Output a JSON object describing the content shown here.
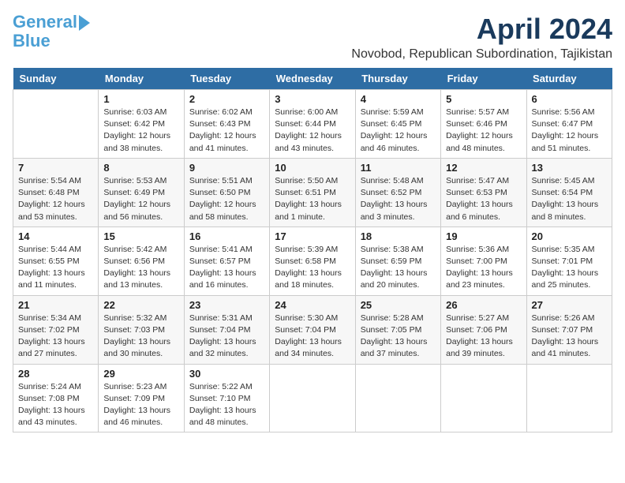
{
  "logo": {
    "line1": "General",
    "line2": "Blue"
  },
  "title": "April 2024",
  "location": "Novobod, Republican Subordination, Tajikistan",
  "header_days": [
    "Sunday",
    "Monday",
    "Tuesday",
    "Wednesday",
    "Thursday",
    "Friday",
    "Saturday"
  ],
  "weeks": [
    [
      {
        "day": "",
        "info": ""
      },
      {
        "day": "1",
        "info": "Sunrise: 6:03 AM\nSunset: 6:42 PM\nDaylight: 12 hours\nand 38 minutes."
      },
      {
        "day": "2",
        "info": "Sunrise: 6:02 AM\nSunset: 6:43 PM\nDaylight: 12 hours\nand 41 minutes."
      },
      {
        "day": "3",
        "info": "Sunrise: 6:00 AM\nSunset: 6:44 PM\nDaylight: 12 hours\nand 43 minutes."
      },
      {
        "day": "4",
        "info": "Sunrise: 5:59 AM\nSunset: 6:45 PM\nDaylight: 12 hours\nand 46 minutes."
      },
      {
        "day": "5",
        "info": "Sunrise: 5:57 AM\nSunset: 6:46 PM\nDaylight: 12 hours\nand 48 minutes."
      },
      {
        "day": "6",
        "info": "Sunrise: 5:56 AM\nSunset: 6:47 PM\nDaylight: 12 hours\nand 51 minutes."
      }
    ],
    [
      {
        "day": "7",
        "info": "Sunrise: 5:54 AM\nSunset: 6:48 PM\nDaylight: 12 hours\nand 53 minutes."
      },
      {
        "day": "8",
        "info": "Sunrise: 5:53 AM\nSunset: 6:49 PM\nDaylight: 12 hours\nand 56 minutes."
      },
      {
        "day": "9",
        "info": "Sunrise: 5:51 AM\nSunset: 6:50 PM\nDaylight: 12 hours\nand 58 minutes."
      },
      {
        "day": "10",
        "info": "Sunrise: 5:50 AM\nSunset: 6:51 PM\nDaylight: 13 hours\nand 1 minute."
      },
      {
        "day": "11",
        "info": "Sunrise: 5:48 AM\nSunset: 6:52 PM\nDaylight: 13 hours\nand 3 minutes."
      },
      {
        "day": "12",
        "info": "Sunrise: 5:47 AM\nSunset: 6:53 PM\nDaylight: 13 hours\nand 6 minutes."
      },
      {
        "day": "13",
        "info": "Sunrise: 5:45 AM\nSunset: 6:54 PM\nDaylight: 13 hours\nand 8 minutes."
      }
    ],
    [
      {
        "day": "14",
        "info": "Sunrise: 5:44 AM\nSunset: 6:55 PM\nDaylight: 13 hours\nand 11 minutes."
      },
      {
        "day": "15",
        "info": "Sunrise: 5:42 AM\nSunset: 6:56 PM\nDaylight: 13 hours\nand 13 minutes."
      },
      {
        "day": "16",
        "info": "Sunrise: 5:41 AM\nSunset: 6:57 PM\nDaylight: 13 hours\nand 16 minutes."
      },
      {
        "day": "17",
        "info": "Sunrise: 5:39 AM\nSunset: 6:58 PM\nDaylight: 13 hours\nand 18 minutes."
      },
      {
        "day": "18",
        "info": "Sunrise: 5:38 AM\nSunset: 6:59 PM\nDaylight: 13 hours\nand 20 minutes."
      },
      {
        "day": "19",
        "info": "Sunrise: 5:36 AM\nSunset: 7:00 PM\nDaylight: 13 hours\nand 23 minutes."
      },
      {
        "day": "20",
        "info": "Sunrise: 5:35 AM\nSunset: 7:01 PM\nDaylight: 13 hours\nand 25 minutes."
      }
    ],
    [
      {
        "day": "21",
        "info": "Sunrise: 5:34 AM\nSunset: 7:02 PM\nDaylight: 13 hours\nand 27 minutes."
      },
      {
        "day": "22",
        "info": "Sunrise: 5:32 AM\nSunset: 7:03 PM\nDaylight: 13 hours\nand 30 minutes."
      },
      {
        "day": "23",
        "info": "Sunrise: 5:31 AM\nSunset: 7:04 PM\nDaylight: 13 hours\nand 32 minutes."
      },
      {
        "day": "24",
        "info": "Sunrise: 5:30 AM\nSunset: 7:04 PM\nDaylight: 13 hours\nand 34 minutes."
      },
      {
        "day": "25",
        "info": "Sunrise: 5:28 AM\nSunset: 7:05 PM\nDaylight: 13 hours\nand 37 minutes."
      },
      {
        "day": "26",
        "info": "Sunrise: 5:27 AM\nSunset: 7:06 PM\nDaylight: 13 hours\nand 39 minutes."
      },
      {
        "day": "27",
        "info": "Sunrise: 5:26 AM\nSunset: 7:07 PM\nDaylight: 13 hours\nand 41 minutes."
      }
    ],
    [
      {
        "day": "28",
        "info": "Sunrise: 5:24 AM\nSunset: 7:08 PM\nDaylight: 13 hours\nand 43 minutes."
      },
      {
        "day": "29",
        "info": "Sunrise: 5:23 AM\nSunset: 7:09 PM\nDaylight: 13 hours\nand 46 minutes."
      },
      {
        "day": "30",
        "info": "Sunrise: 5:22 AM\nSunset: 7:10 PM\nDaylight: 13 hours\nand 48 minutes."
      },
      {
        "day": "",
        "info": ""
      },
      {
        "day": "",
        "info": ""
      },
      {
        "day": "",
        "info": ""
      },
      {
        "day": "",
        "info": ""
      }
    ]
  ]
}
